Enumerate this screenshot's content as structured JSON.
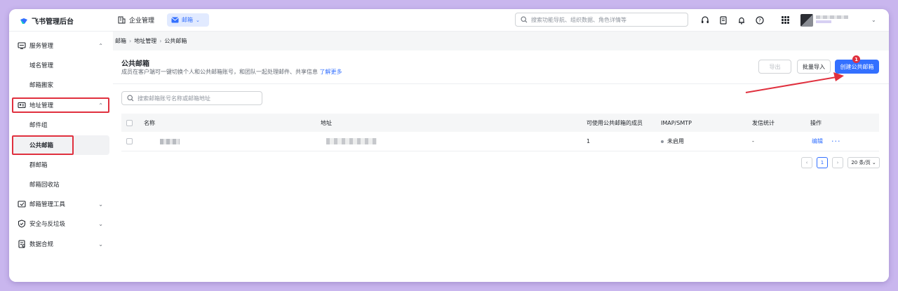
{
  "topbar": {
    "brand": "飞书管理后台",
    "enterprise": "企业管理",
    "mail_tab": "邮箱",
    "search_placeholder": "搜索功能导航、组织数据、角色详情等"
  },
  "sidebar": {
    "items": [
      {
        "label": "服务管理",
        "icon": "server-icon",
        "expanded": true
      },
      {
        "label": "域名管理"
      },
      {
        "label": "邮箱搬家"
      },
      {
        "label": "地址管理",
        "icon": "address-card-icon",
        "expanded": true
      },
      {
        "label": "邮件组"
      },
      {
        "label": "公共邮箱",
        "active": true
      },
      {
        "label": "群邮箱"
      },
      {
        "label": "邮箱回收站"
      },
      {
        "label": "邮箱管理工具",
        "icon": "tools-icon"
      },
      {
        "label": "安全与反垃圾",
        "icon": "shield-icon"
      },
      {
        "label": "数据合规",
        "icon": "doc-check-icon"
      }
    ]
  },
  "breadcrumb": [
    "邮箱",
    "地址管理",
    "公共邮箱"
  ],
  "panel": {
    "title": "公共邮箱",
    "description": "成员在客户端可一键切换个人和公共邮箱账号，和团队一起处理邮件、共享信息",
    "learn_more": "了解更多",
    "export_label": "导出",
    "import_label": "批量导入",
    "create_label": "创建公共邮箱",
    "step_badge": "1",
    "search_placeholder": "搜索邮箱账号名称或邮箱地址"
  },
  "table": {
    "columns": [
      "名称",
      "地址",
      "可使用公共邮箱的成员",
      "IMAP/SMTP",
      "发信统计",
      "操作"
    ],
    "rows": [
      {
        "members": "1",
        "imap": "未启用",
        "stats": "-",
        "edit": "编辑",
        "more": "···"
      }
    ]
  },
  "pagination": {
    "current_page": "1",
    "page_size": "20 条/页"
  },
  "colors": {
    "accent": "#3370ff",
    "annotation_red": "#e0303e"
  }
}
